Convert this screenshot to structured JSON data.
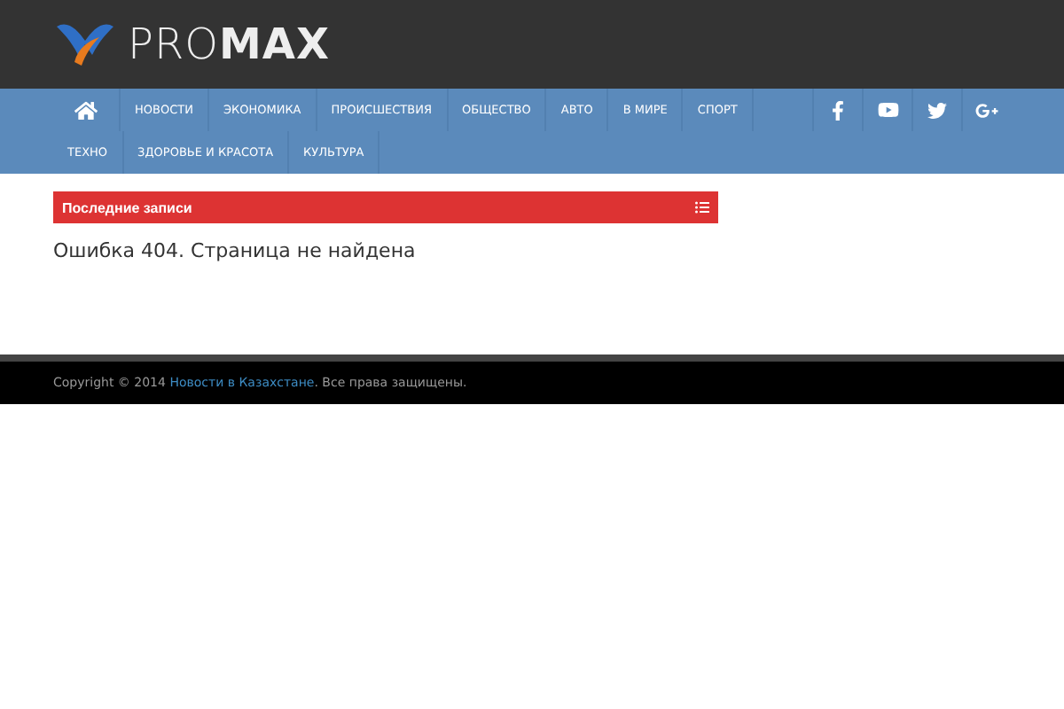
{
  "logo": {
    "text": "PRO**MAX**"
  },
  "nav": {
    "items": [
      {
        "kind": "home",
        "selected": false
      },
      {
        "label": "НОВОСТИ",
        "selected": false
      },
      {
        "label": "ЭКОНОМИКА",
        "selected": false
      },
      {
        "label": "ПРОИСШЕСТВИЯ",
        "selected": false
      },
      {
        "label": "ОБЩЕСТВО",
        "selected": false
      },
      {
        "label": "АВТО",
        "selected": false
      },
      {
        "label": "В МИРЕ",
        "selected": false
      },
      {
        "label": "СПОРТ",
        "selected": false
      },
      {
        "label": "ТЕХНО",
        "selected": false
      },
      {
        "label": "ЗДОРОВЬЕ И КРАСОТА",
        "selected": false
      },
      {
        "label": "КУЛЬТУРА",
        "selected": false
      }
    ],
    "social": [
      {
        "kind": "facebook"
      },
      {
        "kind": "youtube"
      },
      {
        "kind": "twitter"
      },
      {
        "kind": "googleplus"
      }
    ]
  },
  "section_bar": {
    "title": "Последние записи"
  },
  "message": "Ошибка 404. Страница не найдена",
  "footer": {
    "prefix": "Copyright © 2014 ",
    "link": "Новости в Казахстане",
    "suffix": ". Все права защищены."
  }
}
